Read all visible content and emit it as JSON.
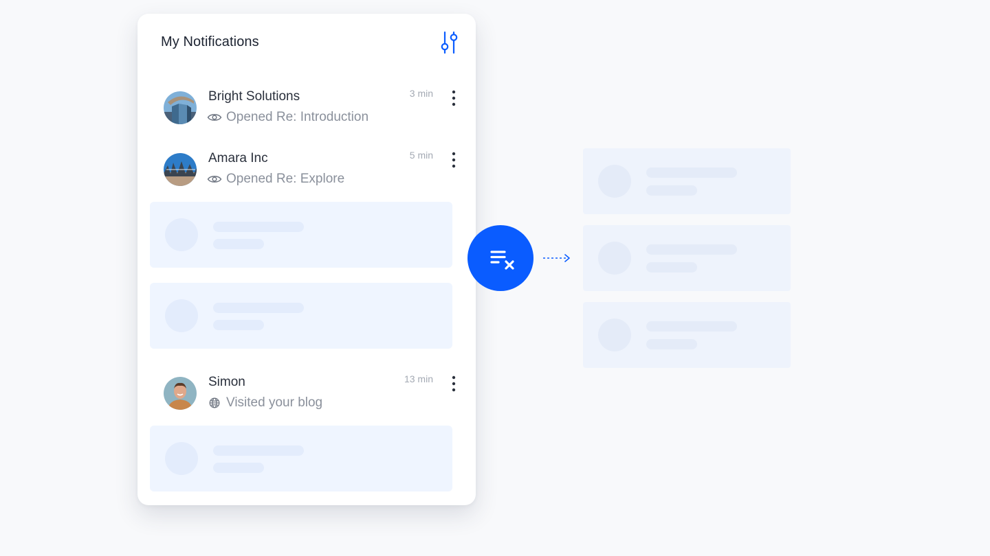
{
  "panel": {
    "title": "My Notifications",
    "filter_icon": "sliders-icon"
  },
  "notifications": [
    {
      "name": "Bright Solutions",
      "activity": "Opened Re: Introduction",
      "activity_icon": "eye-icon",
      "time": "3 min",
      "avatar": "building-photo"
    },
    {
      "name": "Amara Inc",
      "activity": "Opened Re: Explore",
      "activity_icon": "eye-icon",
      "time": "5 min",
      "avatar": "building-photo"
    },
    {
      "name": "Simon",
      "activity": "Visited your blog",
      "activity_icon": "globe-icon",
      "time": "13 min",
      "avatar": "person-photo"
    }
  ],
  "actions": {
    "clear_icon": "clear-list-icon",
    "arrow_icon": "dashed-arrow-right-icon"
  },
  "colors": {
    "accent": "#0a5cff",
    "skeleton_bg": "#eff5ff",
    "skeleton_shape": "#e3ecfc",
    "page_bg": "#f8f9fb"
  }
}
